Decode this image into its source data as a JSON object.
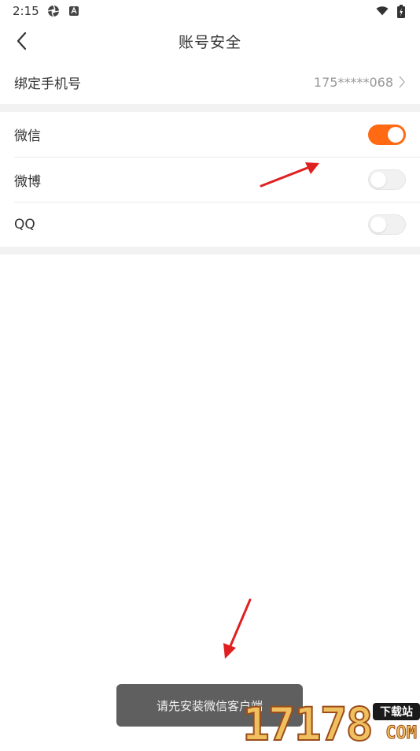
{
  "status_bar": {
    "time": "2:15",
    "icons": [
      "aperture-icon",
      "app-notification-icon",
      "wifi-icon",
      "battery-charging-icon"
    ]
  },
  "nav": {
    "title": "账号安全",
    "back_icon": "chevron-left-icon"
  },
  "phone_binding": {
    "label": "绑定手机号",
    "value": "175*****068"
  },
  "social_bindings": [
    {
      "label": "微信",
      "enabled": true
    },
    {
      "label": "微博",
      "enabled": false
    },
    {
      "label": "QQ",
      "enabled": false
    }
  ],
  "toast": {
    "message": "请先安装微信客户端"
  },
  "watermark": {
    "digits": "17178",
    "badge": "下载站",
    "suffix": "COM"
  },
  "colors": {
    "accent": "#ff6a13",
    "annotation_arrow": "#e02020",
    "toast_bg": "#5f5f5f",
    "section_gap": "#f2f2f2"
  }
}
